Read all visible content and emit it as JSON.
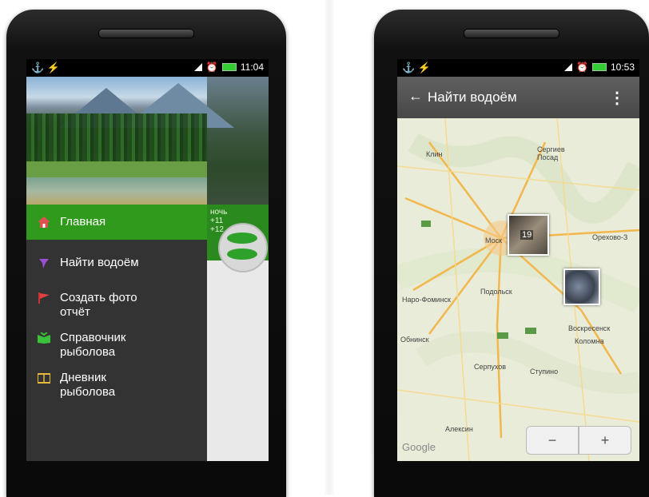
{
  "left_phone": {
    "status": {
      "time": "11:04"
    },
    "drawer": {
      "items": [
        {
          "label": "Главная",
          "icon": "home-icon",
          "icon_color": "#e05252"
        },
        {
          "label": "Найти водоём",
          "icon": "pin-icon",
          "icon_color": "#9b4fd1"
        },
        {
          "label": "Создать фото\nотчёт",
          "icon": "flag-icon",
          "icon_color": "#e04141"
        },
        {
          "label": "Справочник\nрыболова",
          "icon": "book-icon",
          "icon_color": "#3bc23b"
        },
        {
          "label": "Дневник\nрыболова",
          "icon": "diary-icon",
          "icon_color": "#e7b93a"
        }
      ],
      "active_color": "#2f9a1b"
    },
    "bg": {
      "line1": "ночь",
      "line2": "+11",
      "line3": "+12"
    }
  },
  "right_phone": {
    "status": {
      "time": "10:53"
    },
    "actionbar": {
      "back": "←",
      "title": "Найти водоём",
      "more": "⋮"
    },
    "map": {
      "labels": [
        "Клин",
        "Сергиев Посад",
        "Моск",
        "Орехово-З",
        "Наро-Фоминск",
        "Подольск",
        "Воскресенск",
        "Обнинск",
        "Коломна",
        "Серпухов",
        "Ступино",
        "Алексин"
      ],
      "cluster_count": "19",
      "google": "Google",
      "zoom_out": "−",
      "zoom_in": "+"
    }
  }
}
